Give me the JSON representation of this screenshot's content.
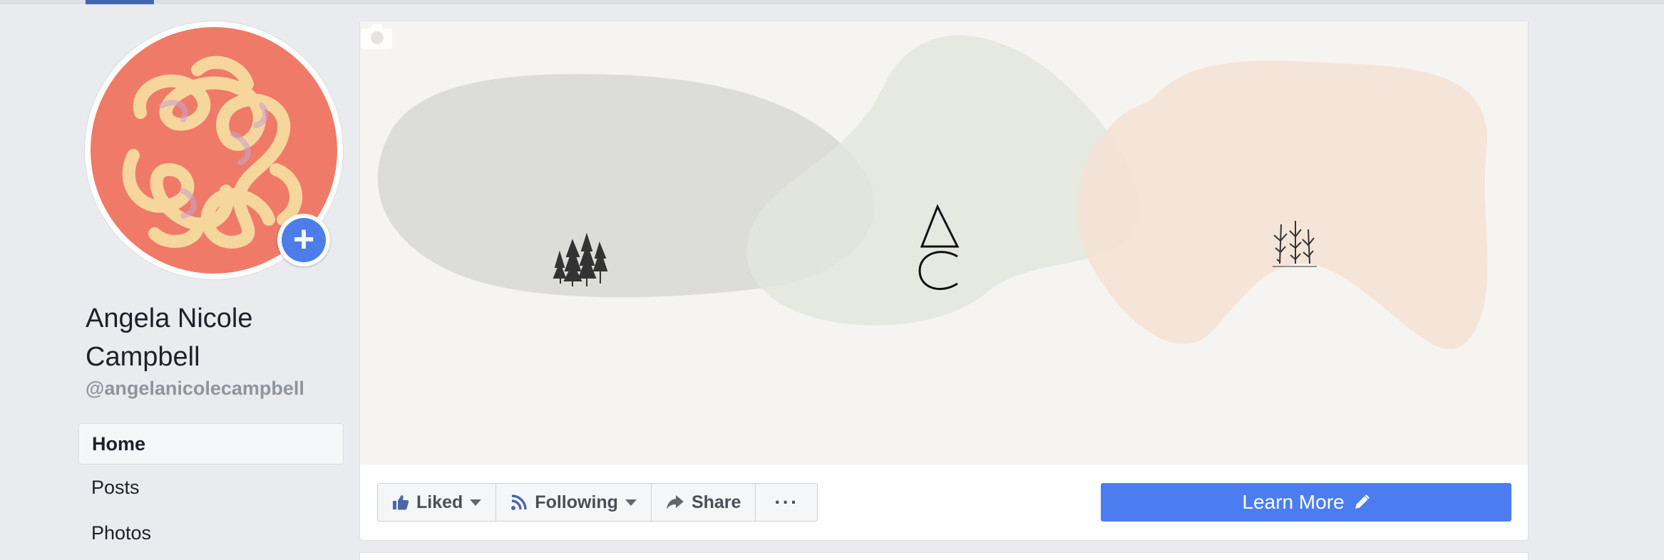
{
  "profile": {
    "name": "Angela Nicole Campbell",
    "handle": "@angelanicolecampbell",
    "avatar_colors": {
      "background": "#f07a68",
      "swirl": "#f6dca0",
      "accent": "#c9a2c8"
    },
    "add_icon": "plus-icon"
  },
  "sidebar": {
    "items": [
      {
        "label": "Home",
        "active": true
      },
      {
        "label": "Posts",
        "active": false
      },
      {
        "label": "Photos",
        "active": false
      }
    ]
  },
  "cover": {
    "camera_icon": "camera-icon",
    "monogram": [
      "A",
      "C"
    ],
    "colors": {
      "background": "#f6f4f1",
      "blob_grey": "#dcdcda",
      "blob_sage": "#e5e8df",
      "blob_peach": "#f7e6da"
    }
  },
  "actions": {
    "liked": {
      "label": "Liked",
      "icon": "thumbs-up-icon"
    },
    "following": {
      "label": "Following",
      "icon": "rss-icon"
    },
    "share": {
      "label": "Share",
      "icon": "share-arrow-icon"
    },
    "more": {
      "label": "···",
      "icon": "more-icon"
    }
  },
  "cta": {
    "label": "Learn More",
    "icon": "pencil-icon",
    "color": "#4c7df0"
  }
}
